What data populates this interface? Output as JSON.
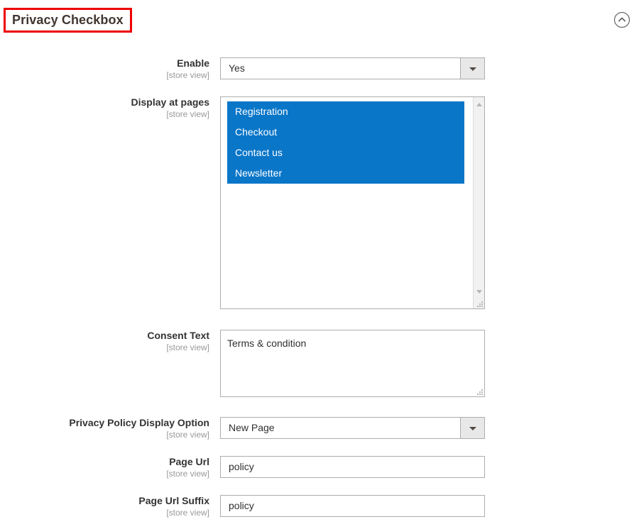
{
  "section": {
    "title": "Privacy Checkbox",
    "highlight_color": "#ee0000",
    "collapse_icon": "chevron-up-circle-icon"
  },
  "accent_color": "#0a76c8",
  "scope_label": "[store view]",
  "fields": [
    {
      "id": "enable",
      "label": "Enable",
      "scope": "[store view]",
      "type": "select",
      "value": "Yes"
    },
    {
      "id": "display_at_pages",
      "label": "Display at pages",
      "scope": "[store view]",
      "type": "multiselect",
      "options": [
        {
          "label": "Registration",
          "selected": true
        },
        {
          "label": "Checkout",
          "selected": true
        },
        {
          "label": "Contact us",
          "selected": true
        },
        {
          "label": "Newsletter",
          "selected": true
        }
      ]
    },
    {
      "id": "consent_text",
      "label": "Consent Text",
      "scope": "[store view]",
      "type": "textarea",
      "value": "Terms & condition"
    },
    {
      "id": "privacy_policy_display_option",
      "label": "Privacy Policy Display Option",
      "scope": "[store view]",
      "type": "select",
      "value": "New Page"
    },
    {
      "id": "page_url",
      "label": "Page Url",
      "scope": "[store view]",
      "type": "text",
      "value": "policy"
    },
    {
      "id": "page_url_suffix",
      "label": "Page Url Suffix",
      "scope": "[store view]",
      "type": "text",
      "value": "policy"
    }
  ]
}
